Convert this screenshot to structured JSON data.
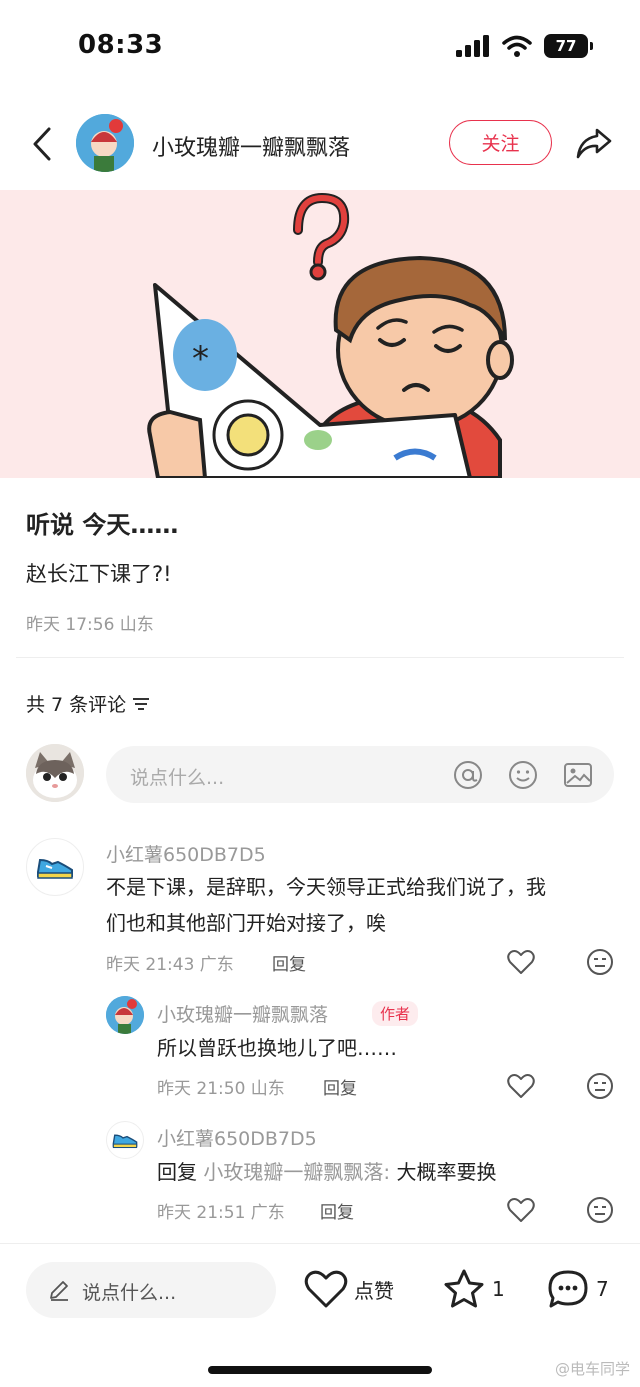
{
  "status": {
    "time": "08:33",
    "battery": "77"
  },
  "header": {
    "author_name": "小玫瑰瓣一瓣飘飘落",
    "follow_label": "关注"
  },
  "post": {
    "title": "听说 今天……",
    "text": "赵长江下课了?!",
    "meta": "昨天 17:56 山东"
  },
  "comments_header": {
    "count_label": "共 7 条评论"
  },
  "comment_input": {
    "placeholder": "说点什么..."
  },
  "comments": [
    {
      "user": "小红薯650DB7D5",
      "text_line1": "不是下课，是辞职，今天领导正式给我们说了，我",
      "text_line2": "们也和其他部门开始对接了，唉",
      "meta": "昨天 21:43 广东",
      "reply_label": "回复"
    },
    {
      "user": "小玫瑰瓣一瓣飘飘落",
      "tag": "作者",
      "text": "所以曾跃也换地儿了吧……",
      "meta": "昨天 21:50 山东",
      "reply_label": "回复"
    },
    {
      "user": "小红薯650DB7D5",
      "reply_prefix": "回复",
      "reply_to": "小玫瑰瓣一瓣飘飘落:",
      "text": "大概率要换",
      "meta": "昨天 21:51 广东",
      "reply_label": "回复"
    }
  ],
  "bottom_bar": {
    "input_placeholder": "说点什么...",
    "like_label": "点赞",
    "star_count": "1",
    "comment_count": "7"
  },
  "watermark": "@电车同学",
  "colors": {
    "accent": "#e8324d",
    "hero_bg": "#fde9e9"
  }
}
